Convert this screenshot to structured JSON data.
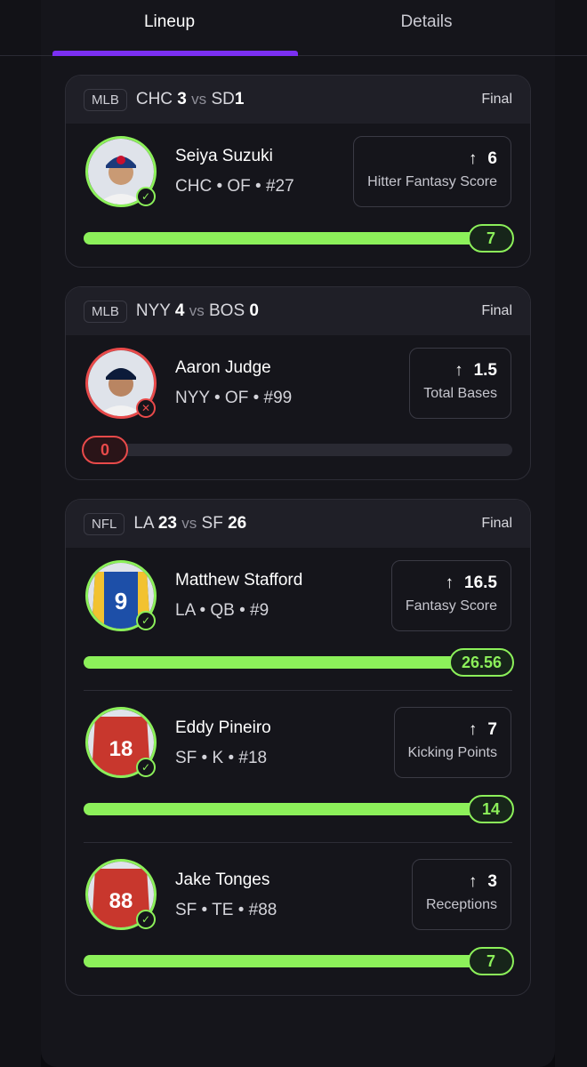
{
  "tabs": [
    {
      "label": "Lineup",
      "active": true
    },
    {
      "label": "Details",
      "active": false
    }
  ],
  "colors": {
    "accent": "#7b2ff2",
    "hit": "#8cf05a",
    "miss": "#e84a4a"
  },
  "games": [
    {
      "league": "MLB",
      "away_team": "CHC",
      "away_score": "3",
      "vs": "vs",
      "home_team": "SD",
      "home_score": "1",
      "status": "Final",
      "players": [
        {
          "name": "Seiya Suzuki",
          "meta": "CHC • OF • #27",
          "stat_value": "6",
          "stat_label": "Hitter Fantasy Score",
          "result": "7",
          "progress": 1.0,
          "hit": true,
          "icon": "check-icon"
        }
      ]
    },
    {
      "league": "MLB",
      "away_team": "NYY",
      "away_score": "4",
      "vs": "vs",
      "home_team": "BOS",
      "home_score": "0",
      "status": "Final",
      "players": [
        {
          "name": "Aaron Judge",
          "meta": "NYY • OF • #99",
          "stat_value": "1.5",
          "stat_label": "Total Bases",
          "result": "0",
          "progress": 0.0,
          "hit": false,
          "icon": "x-icon"
        }
      ]
    },
    {
      "league": "NFL",
      "away_team": "LA",
      "away_score": "23",
      "vs": "vs",
      "home_team": "SF",
      "home_score": "26",
      "status": "Final",
      "players": [
        {
          "name": "Matthew Stafford",
          "meta": "LA • QB • #9",
          "stat_value": "16.5",
          "stat_label": "Fantasy Score",
          "result": "26.56",
          "progress": 1.0,
          "hit": true,
          "icon": "check-icon"
        },
        {
          "name": "Eddy Pineiro",
          "meta": "SF • K • #18",
          "stat_value": "7",
          "stat_label": "Kicking Points",
          "result": "14",
          "progress": 1.0,
          "hit": true,
          "icon": "check-icon"
        },
        {
          "name": "Jake Tonges",
          "meta": "SF • TE • #88",
          "stat_value": "3",
          "stat_label": "Receptions",
          "result": "7",
          "progress": 1.0,
          "hit": true,
          "icon": "check-icon"
        }
      ]
    }
  ]
}
